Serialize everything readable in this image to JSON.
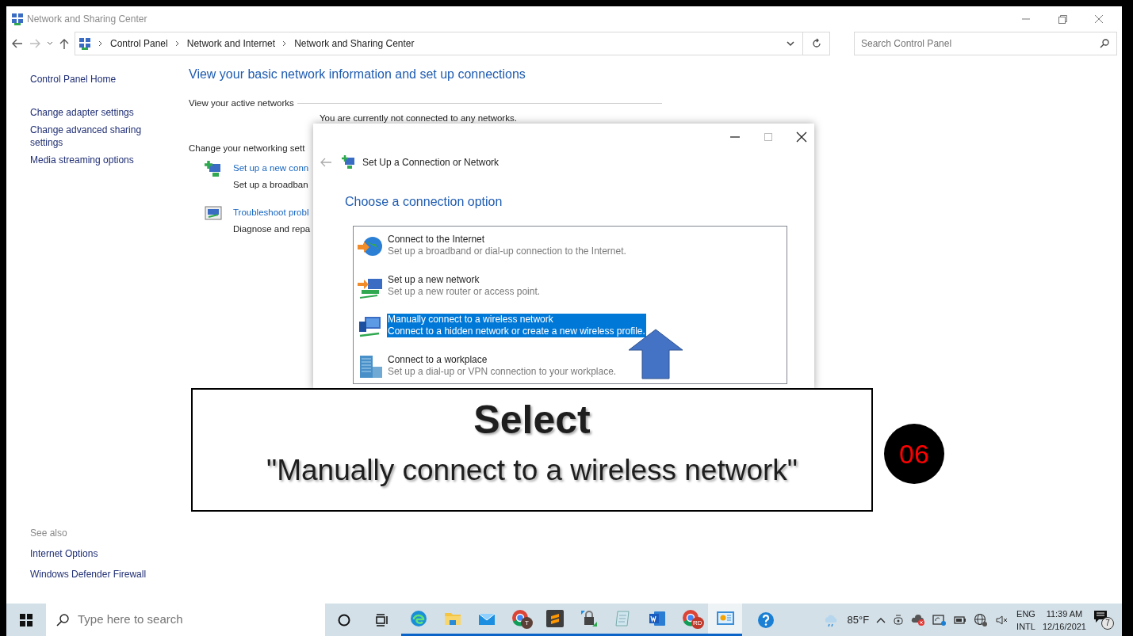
{
  "window": {
    "title": "Network and Sharing Center"
  },
  "address_bar": {
    "breadcrumb": [
      "Control Panel",
      "Network and Internet",
      "Network and Sharing Center"
    ]
  },
  "search": {
    "placeholder": "Search Control Panel"
  },
  "sidebar": {
    "items": [
      "Control Panel Home",
      "Change adapter settings",
      "Change advanced sharing settings",
      "Media streaming options"
    ],
    "see_also": {
      "heading": "See also",
      "items": [
        "Internet Options",
        "Windows Defender Firewall"
      ]
    }
  },
  "main": {
    "heading": "View your basic network information and set up connections",
    "active_networks_label": "View your active networks",
    "status": "You are currently not connected to any networks.",
    "change_label": "Change your networking sett",
    "tasks": [
      {
        "kind": "setup",
        "title": "Set up a new conn",
        "description": "Set up a broadban"
      },
      {
        "kind": "troubleshoot",
        "title": "Troubleshoot probl",
        "description": "Diagnose and repa"
      }
    ]
  },
  "dialog": {
    "title": "Set Up a Connection or Network",
    "heading": "Choose a connection option",
    "options": [
      {
        "kind": "internet",
        "title": "Connect to the Internet",
        "description": "Set up a broadband or dial-up connection to the Internet.",
        "selected": false
      },
      {
        "kind": "new-network",
        "title": "Set up a new network",
        "description": "Set up a new router or access point.",
        "selected": false
      },
      {
        "kind": "wireless",
        "title": "Manually connect to a wireless network",
        "description": "Connect to a hidden network or create a new wireless profile.",
        "selected": true
      },
      {
        "kind": "workplace",
        "title": "Connect to a workplace",
        "description": "Set up a dial-up or VPN connection to your workplace.",
        "selected": false
      }
    ]
  },
  "callout": {
    "title": "Select",
    "text": "\"Manually connect to a wireless network\"",
    "step": "06"
  },
  "taskbar": {
    "search_placeholder": "Type here to search",
    "apps": [
      {
        "kind": "edge",
        "selected": false
      },
      {
        "kind": "explorer",
        "selected": false
      },
      {
        "kind": "mail",
        "selected": false
      },
      {
        "kind": "chrome",
        "badge": "T",
        "selected": false
      },
      {
        "kind": "sublime",
        "selected": false
      },
      {
        "kind": "lock",
        "selected": false
      },
      {
        "kind": "notepad",
        "selected": false
      },
      {
        "kind": "word",
        "selected": false
      },
      {
        "kind": "chrome",
        "badge": "RD",
        "selected": false
      },
      {
        "kind": "control-panel",
        "selected": true
      }
    ],
    "weather": "85°F",
    "language": [
      "ENG",
      "INTL"
    ],
    "time": "11:39 AM",
    "date": "12/16/2021",
    "notifications": "7"
  }
}
